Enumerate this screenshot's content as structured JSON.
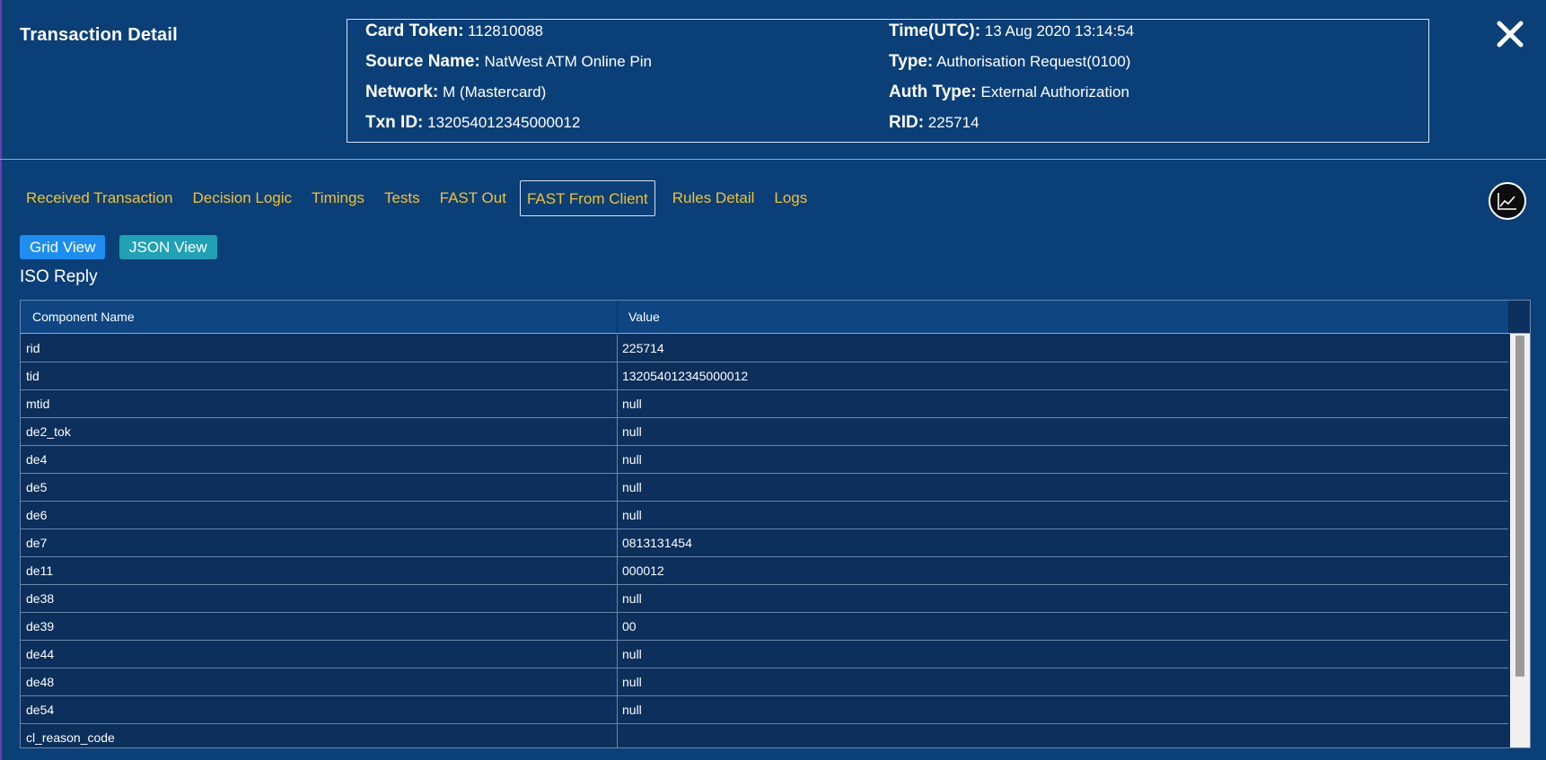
{
  "modal": {
    "title": "Transaction Detail"
  },
  "info": {
    "card_token_label": "Card Token:",
    "card_token_value": "112810088",
    "source_name_label": "Source Name:",
    "source_name_value": "NatWest ATM Online Pin",
    "network_label": "Network:",
    "network_value": "M (Mastercard)",
    "txn_id_label": "Txn ID:",
    "txn_id_value": "132054012345000012",
    "time_label": "Time(UTC):",
    "time_value": "13 Aug 2020 13:14:54",
    "type_label": "Type:",
    "type_value": "Authorisation Request(0100)",
    "auth_type_label": "Auth Type:",
    "auth_type_value": "External Authorization",
    "rid_label": "RID:",
    "rid_value": "225714"
  },
  "tabs": [
    {
      "label": "Received Transaction"
    },
    {
      "label": "Decision Logic"
    },
    {
      "label": "Timings"
    },
    {
      "label": "Tests"
    },
    {
      "label": "FAST Out"
    },
    {
      "label": "FAST From Client"
    },
    {
      "label": "Rules Detail"
    },
    {
      "label": "Logs"
    }
  ],
  "active_tab": "FAST From Client",
  "views": {
    "grid_label": "Grid View",
    "json_label": "JSON View"
  },
  "section": {
    "title": "ISO Reply"
  },
  "grid": {
    "columns": [
      "Component Name",
      "Value"
    ],
    "rows": [
      {
        "name": "rid",
        "value": "225714"
      },
      {
        "name": "tid",
        "value": "132054012345000012"
      },
      {
        "name": "mtid",
        "value": "null"
      },
      {
        "name": "de2_tok",
        "value": "null"
      },
      {
        "name": "de4",
        "value": "null"
      },
      {
        "name": "de5",
        "value": "null"
      },
      {
        "name": "de6",
        "value": "null"
      },
      {
        "name": "de7",
        "value": "0813131454"
      },
      {
        "name": "de11",
        "value": "000012"
      },
      {
        "name": "de38",
        "value": "null"
      },
      {
        "name": "de39",
        "value": "00"
      },
      {
        "name": "de44",
        "value": "null"
      },
      {
        "name": "de48",
        "value": "null"
      },
      {
        "name": "de54",
        "value": "null"
      },
      {
        "name": "cl_reason_code",
        "value": ""
      }
    ]
  },
  "icons": {
    "close": "close-icon",
    "chart": "line-chart-icon"
  },
  "colors": {
    "background": "#0b3f78",
    "tab_text": "#f2c230",
    "grid_view_button": "#1d8ef0",
    "json_view_button": "#20a1b6"
  }
}
